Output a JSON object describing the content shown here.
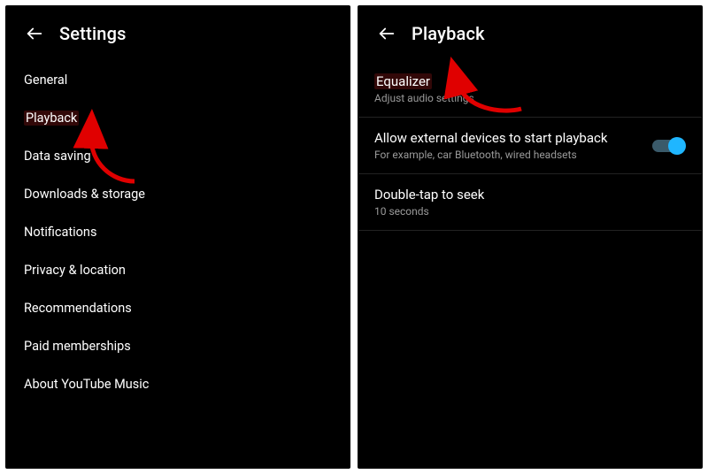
{
  "left": {
    "title": "Settings",
    "items": [
      "General",
      "Playback",
      "Data saving",
      "Downloads & storage",
      "Notifications",
      "Privacy & location",
      "Recommendations",
      "Paid memberships",
      "About YouTube Music"
    ],
    "highlightIndex": 1
  },
  "right": {
    "title": "Playback",
    "sections": [
      {
        "primary": "Equalizer",
        "secondary": "Adjust audio settings",
        "highlight": true
      },
      {
        "primary": "Allow external devices to start playback",
        "secondary": "For example, car Bluetooth, wired headsets",
        "toggle": true,
        "toggleOn": true
      },
      {
        "primary": "Double-tap to seek",
        "secondary": "10 seconds"
      }
    ]
  },
  "annotations": {
    "leftArrow": true,
    "rightArrow": true
  }
}
